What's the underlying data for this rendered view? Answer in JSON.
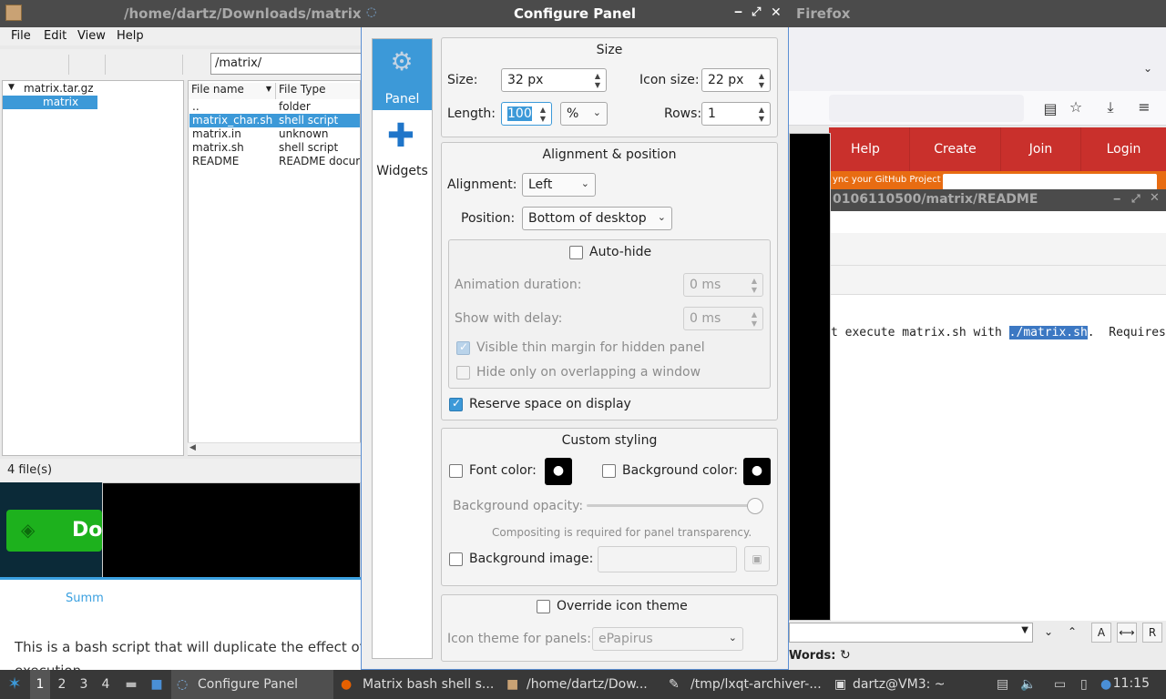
{
  "firefox": {
    "title": "Firefox",
    "nav": [
      "Help",
      "Create",
      "Join",
      "Login"
    ],
    "sync_text": "ync your GitHub Project"
  },
  "archiver_right": {
    "title": "0106110500/matrix/README",
    "readme_before": "t execute matrix.sh with ",
    "readme_highlight": "./matrix.sh",
    "readme_after": ".  Requires",
    "words_label": "Words:"
  },
  "archiver": {
    "title": "/home/dartz/Downloads/matrix",
    "menu": [
      "File",
      "Edit",
      "View",
      "Help"
    ],
    "path": "/matrix/",
    "tree": [
      "matrix.tar.gz",
      "matrix"
    ],
    "columns": [
      "File name",
      "File Type"
    ],
    "rows": [
      {
        "name": "..",
        "type": "folder"
      },
      {
        "name": "matrix_char.sh",
        "type": "shell script"
      },
      {
        "name": "matrix.in",
        "type": "unknown"
      },
      {
        "name": "matrix.sh",
        "type": "shell script"
      },
      {
        "name": "README",
        "type": "README docur"
      }
    ],
    "status": "4 file(s)"
  },
  "webpage": {
    "download_label": "Do",
    "summary_tab": "Summ",
    "description": "This is a bash script that will duplicate the effect of the",
    "description2": "execution"
  },
  "dialog": {
    "title": "Configure Panel",
    "sidebar": [
      {
        "label": "Panel",
        "icon": "gear-icon"
      },
      {
        "label": "Widgets",
        "icon": "puzzle-icon"
      }
    ],
    "size": {
      "title": "Size",
      "size_label": "Size:",
      "size_value": "32 px",
      "icon_size_label": "Icon size:",
      "icon_size_value": "22 px",
      "length_label": "Length:",
      "length_value": "100",
      "length_unit": "%",
      "rows_label": "Rows:",
      "rows_value": "1"
    },
    "alignment": {
      "title": "Alignment & position",
      "alignment_label": "Alignment:",
      "alignment_value": "Left",
      "position_label": "Position:",
      "position_value": "Bottom of desktop",
      "autohide_label": "Auto-hide",
      "anim_label": "Animation duration:",
      "anim_value": "0 ms",
      "delay_label": "Show with delay:",
      "delay_value": "0 ms",
      "thin_margin_label": "Visible thin margin for hidden panel",
      "overlap_label": "Hide only on overlapping a window",
      "reserve_label": "Reserve space on display"
    },
    "styling": {
      "title": "Custom styling",
      "font_color_label": "Font color:",
      "bg_color_label": "Background color:",
      "opacity_label": "Background opacity:",
      "opacity_value": 1.0,
      "compositing_note": "Compositing is required for panel transparency.",
      "bg_image_label": "Background image:"
    },
    "icon_theme": {
      "override_label": "Override icon theme",
      "theme_label": "Icon theme for panels:",
      "theme_value": "ePapirus"
    }
  },
  "taskbar": {
    "desktops": [
      "1",
      "2",
      "3",
      "4"
    ],
    "tasks": [
      {
        "label": "Configure Panel"
      },
      {
        "label": "Matrix bash shell s..."
      },
      {
        "label": "/home/dartz/Dow..."
      },
      {
        "label": "/tmp/lxqt-archiver-..."
      },
      {
        "label": "dartz@VM3: ~"
      }
    ],
    "clock": "11:15"
  },
  "colors": {
    "accent": "#3c99d8",
    "titlebar": "#4b4b4b",
    "taskbar": "#383838",
    "nav_red": "#c9302c",
    "download_green": "#1db11d"
  }
}
